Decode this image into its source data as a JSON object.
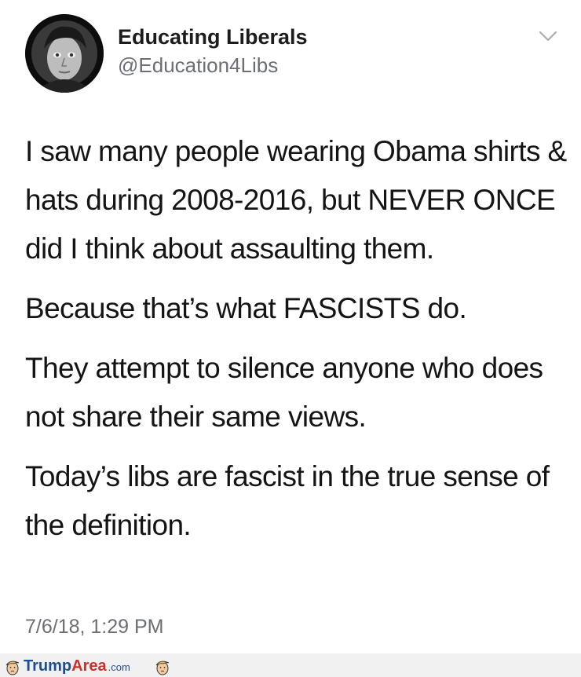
{
  "tweet": {
    "display_name": "Educating Liberals",
    "handle": "@Education4Libs",
    "avatar_icon": "profile-photo-icon",
    "menu_icon": "chevron-down-icon",
    "paragraphs": [
      "I saw many people wearing Obama shirts & hats during 2008-2016, but NEVER ONCE did I think about assaulting them.",
      "Because that’s what FASCISTS do.",
      "They attempt to silence anyone who does not share their same views.",
      "Today’s libs are fascist in the true sense of the definition."
    ],
    "timestamp": "7/6/18, 1:29 PM"
  },
  "watermark": {
    "part1": "Trump",
    "part2": "Area",
    "part3": ".com",
    "icon": "trump-face-icon"
  },
  "colors": {
    "name": "#1c1c1c",
    "secondary": "#6b6f73",
    "watermark_blue": "#1f4e8c",
    "watermark_red": "#c9312c"
  }
}
